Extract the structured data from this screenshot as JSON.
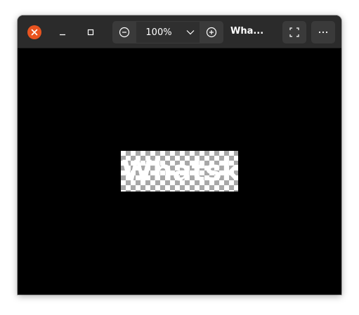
{
  "titlebar": {
    "close_icon": "close-icon",
    "minimize_icon": "minimize-icon",
    "maximize_icon": "maximize-icon",
    "title": "Wha...",
    "fullscreen_icon": "fullscreen-icon",
    "menu_icon": "more-options-icon",
    "accent_color": "#e95420"
  },
  "zoom": {
    "zoom_out_icon": "zoom-out-icon",
    "value": "100%",
    "dropdown_icon": "chevron-down-icon",
    "zoom_in_icon": "zoom-in-icon"
  },
  "viewer": {
    "image_text": "Whatsk"
  }
}
